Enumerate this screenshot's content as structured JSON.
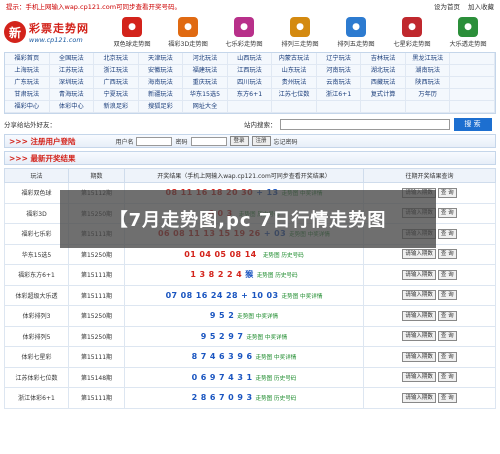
{
  "topbar": {
    "notice": "提示：手机上网输入wap.cp121.com可同步查看开奖号码。",
    "set_home": "设为首页",
    "add_fav": "加入收藏"
  },
  "logo": {
    "glyph": "新",
    "title": "彩票走势网",
    "url": "www.cp121.com"
  },
  "nav_icons": [
    {
      "label": "双色球走势图",
      "color": "#d3231b"
    },
    {
      "label": "福彩3D走势图",
      "color": "#e06a12"
    },
    {
      "label": "七乐彩走势图",
      "color": "#b8308a"
    },
    {
      "label": "排列三走势图",
      "color": "#d48a10"
    },
    {
      "label": "排列五走势图",
      "color": "#2d7bd0"
    },
    {
      "label": "七星彩走势图",
      "color": "#c0282e"
    },
    {
      "label": "大乐透走势图",
      "color": "#2b8f3a"
    }
  ],
  "link_grid": [
    "福彩首页",
    "全国玩法",
    "北京玩法",
    "天津玩法",
    "河北玩法",
    "山西玩法",
    "内蒙古玩法",
    "辽宁玩法",
    "吉林玩法",
    "黑龙江玩法",
    "",
    "上海玩法",
    "江苏玩法",
    "浙江玩法",
    "安徽玩法",
    "福建玩法",
    "江西玩法",
    "山东玩法",
    "河南玩法",
    "湖北玩法",
    "湖南玩法",
    "",
    "广东玩法",
    "深圳玩法",
    "广西玩法",
    "海南玩法",
    "重庆玩法",
    "四川玩法",
    "贵州玩法",
    "云南玩法",
    "西藏玩法",
    "陕西玩法",
    "",
    "甘肃玩法",
    "青海玩法",
    "宁夏玩法",
    "新疆玩法",
    "华东15选5",
    "东方6+1",
    "江苏七位数",
    "浙江6+1",
    "复式计算",
    "万年历",
    "",
    "福彩中心",
    "体彩中心",
    "新浪足彩",
    "搜狐足彩",
    "网址大全",
    "",
    "",
    "",
    "",
    "",
    ""
  ],
  "searchbar": {
    "friends_label": "分享给站外好友：",
    "search_label": "站内搜索：",
    "search_value": "",
    "search_button": "搜 索"
  },
  "register": {
    "title": ">>> 注册用户登陆",
    "user_label": "用户名",
    "pwd_label": "密码",
    "login_btn": "登录",
    "register_btn": "注册",
    "forgot": "忘记密码"
  },
  "results": {
    "title": ">>> 最新开奖结果",
    "headers": [
      "玩法",
      "期数",
      "开奖结果（手机上网输入wap.cp121.com可同步查看开奖结果）",
      "往期开奖结果查询"
    ],
    "query_input_label": "请输入期数",
    "query_btn": "查 询",
    "rows": [
      {
        "game": "福彩双色球",
        "issue": "第15112期",
        "red": "08 11 16 18 20 30",
        "blue": "+ 13",
        "links": "走势图  中奖详情"
      },
      {
        "game": "福彩3D",
        "issue": "第15250期",
        "red": "6 0 3",
        "blue": "",
        "links": "走势图  历史号码"
      },
      {
        "game": "福彩七乐彩",
        "issue": "第15111期",
        "red": "06 08 11 13 15 19 26",
        "blue": "+ 03",
        "links": "走势图  中奖详情"
      },
      {
        "game": "华东15选5",
        "issue": "第15250期",
        "red": "01 04 05 08 14",
        "blue": "",
        "links": "走势图  历史号码"
      },
      {
        "game": "福彩东方6+1",
        "issue": "第15111期",
        "red": "1 3 8 2 2 4",
        "blue": "猴",
        "links": "走势图  历史号码"
      },
      {
        "game": "体彩超级大乐透",
        "issue": "第15111期",
        "red": "",
        "blue": "07 08 16 24 28 + 10 03",
        "links": "走势图  中奖详情"
      },
      {
        "game": "体彩排列3",
        "issue": "第15250期",
        "red": "",
        "blue": "9 5 2",
        "links": "走势图  中奖详情"
      },
      {
        "game": "体彩排列5",
        "issue": "第15250期",
        "red": "",
        "blue": "9 5 2 9 7",
        "links": "走势图  中奖详情"
      },
      {
        "game": "体彩七星彩",
        "issue": "第15111期",
        "red": "",
        "blue": "8 7 4 6 3 9 6",
        "links": "走势图  中奖详情"
      },
      {
        "game": "江苏体彩七位数",
        "issue": "第15148期",
        "red": "",
        "blue": "0 6 9 7 4 3 1",
        "links": "走势图  历史号码"
      },
      {
        "game": "浙江体彩6+1",
        "issue": "第15111期",
        "red": "",
        "blue": "2 8 6 7 0 9 3",
        "links": "走势图  历史号码"
      }
    ]
  },
  "overlay": {
    "text": "【7月走势图,pc 7日行情走势图"
  }
}
